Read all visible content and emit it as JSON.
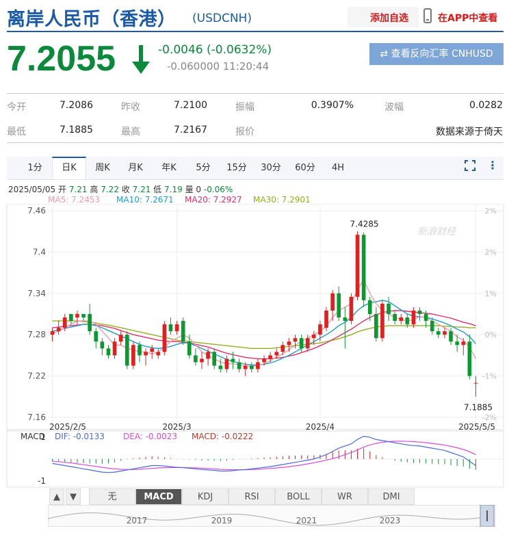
{
  "header": {
    "title": "离岸人民币（香港）",
    "code": "(USDCNH)",
    "add_favorite": "添加自选",
    "app_view": "在APP中查看"
  },
  "quote": {
    "price": "7.2055",
    "change": "-0.0046 (-0.0632%)",
    "sub": "-0.060000 11:20:44",
    "reverse_button": "查看反向汇率 CNHUSD",
    "status_color": "#0a8a3a"
  },
  "stats": {
    "row1": [
      {
        "label": "今开",
        "value": "7.2086"
      },
      {
        "label": "昨收",
        "value": "7.2100"
      },
      {
        "label": "振幅",
        "value": "0.3907%"
      },
      {
        "label": "波幅",
        "value": "0.0282"
      }
    ],
    "row2": [
      {
        "label": "最低",
        "value": "7.1885"
      },
      {
        "label": "最高",
        "value": "7.2167"
      },
      {
        "label": "报价",
        "value": "数据来源于倚天"
      }
    ]
  },
  "tabs": [
    "1分",
    "日K",
    "周K",
    "月K",
    "年K",
    "5分",
    "15分",
    "30分",
    "60分",
    "4H"
  ],
  "active_tab": "日K",
  "info_line": {
    "date": "2025/05/05",
    "open_label": "开",
    "open": "7.21",
    "high_label": "高",
    "high": "7.22",
    "close_label": "收",
    "close": "7.21",
    "low_label": "低",
    "low": "7.19",
    "vol_label": "量",
    "vol": "0",
    "pct": "-0.06%"
  },
  "ma_legend": [
    {
      "label": "MA5: 7.2453",
      "color": "#f29aa8"
    },
    {
      "label": "MA10: 7.2671",
      "color": "#1aa0c8"
    },
    {
      "label": "MA20: 7.2927",
      "color": "#e0306a"
    },
    {
      "label": "MA30: 7.2901",
      "color": "#95ad1e"
    }
  ],
  "watermark": "新浪财经",
  "chart_data": {
    "type": "candlestick",
    "y_ticks": [
      "7.46",
      "7.4",
      "7.34",
      "7.28",
      "7.22",
      "7.16"
    ],
    "y_values": [
      7.46,
      7.4,
      7.34,
      7.28,
      7.22,
      7.16
    ],
    "right_ticks": [
      "2%",
      "2%",
      "1%",
      "0%",
      "-1%",
      "-2%"
    ],
    "x_labels": [
      "2025/2/5",
      "2025/3",
      "2025/4",
      "2025/5/5"
    ],
    "x_label_index": [
      0,
      20,
      43,
      68
    ],
    "annotations": {
      "high": "7.4285",
      "low": "7.1885"
    },
    "ylim": [
      7.16,
      7.46
    ],
    "ohlc": [
      [
        7.28,
        7.29,
        7.27,
        7.285
      ],
      [
        7.285,
        7.3,
        7.28,
        7.29
      ],
      [
        7.29,
        7.31,
        7.285,
        7.305
      ],
      [
        7.31,
        7.31,
        7.295,
        7.3
      ],
      [
        7.305,
        7.315,
        7.295,
        7.31
      ],
      [
        7.31,
        7.31,
        7.3,
        7.305
      ],
      [
        7.31,
        7.325,
        7.28,
        7.285
      ],
      [
        7.285,
        7.29,
        7.26,
        7.27
      ],
      [
        7.27,
        7.275,
        7.25,
        7.26
      ],
      [
        7.26,
        7.265,
        7.245,
        7.25
      ],
      [
        7.25,
        7.275,
        7.245,
        7.27
      ],
      [
        7.27,
        7.285,
        7.265,
        7.28
      ],
      [
        7.28,
        7.285,
        7.23,
        7.235
      ],
      [
        7.235,
        7.27,
        7.23,
        7.265
      ],
      [
        7.265,
        7.27,
        7.24,
        7.25
      ],
      [
        7.25,
        7.26,
        7.235,
        7.255
      ],
      [
        7.255,
        7.265,
        7.245,
        7.26
      ],
      [
        7.25,
        7.26,
        7.245,
        7.255
      ],
      [
        7.255,
        7.3,
        7.25,
        7.295
      ],
      [
        7.295,
        7.305,
        7.28,
        7.285
      ],
      [
        7.285,
        7.3,
        7.28,
        7.295
      ],
      [
        7.3,
        7.305,
        7.265,
        7.27
      ],
      [
        7.27,
        7.28,
        7.245,
        7.25
      ],
      [
        7.25,
        7.26,
        7.235,
        7.24
      ],
      [
        7.24,
        7.255,
        7.23,
        7.245
      ],
      [
        7.245,
        7.26,
        7.235,
        7.255
      ],
      [
        7.255,
        7.26,
        7.23,
        7.235
      ],
      [
        7.235,
        7.245,
        7.225,
        7.23
      ],
      [
        7.23,
        7.25,
        7.225,
        7.245
      ],
      [
        7.245,
        7.255,
        7.23,
        7.24
      ],
      [
        7.24,
        7.245,
        7.225,
        7.23
      ],
      [
        7.23,
        7.24,
        7.22,
        7.235
      ],
      [
        7.235,
        7.24,
        7.225,
        7.23
      ],
      [
        7.23,
        7.245,
        7.225,
        7.24
      ],
      [
        7.24,
        7.25,
        7.235,
        7.245
      ],
      [
        7.245,
        7.255,
        7.24,
        7.25
      ],
      [
        7.25,
        7.26,
        7.245,
        7.255
      ],
      [
        7.255,
        7.27,
        7.25,
        7.265
      ],
      [
        7.265,
        7.275,
        7.255,
        7.27
      ],
      [
        7.27,
        7.28,
        7.26,
        7.275
      ],
      [
        7.275,
        7.28,
        7.255,
        7.26
      ],
      [
        7.26,
        7.28,
        7.255,
        7.275
      ],
      [
        7.275,
        7.285,
        7.265,
        7.28
      ],
      [
        7.28,
        7.3,
        7.27,
        7.295
      ],
      [
        7.29,
        7.32,
        7.285,
        7.315
      ],
      [
        7.315,
        7.345,
        7.3,
        7.34
      ],
      [
        7.34,
        7.35,
        7.3,
        7.305
      ],
      [
        7.305,
        7.32,
        7.26,
        7.3
      ],
      [
        7.3,
        7.34,
        7.295,
        7.335
      ],
      [
        7.335,
        7.43,
        7.33,
        7.425
      ],
      [
        7.425,
        7.4285,
        7.32,
        7.33
      ],
      [
        7.33,
        7.335,
        7.3,
        7.31
      ],
      [
        7.31,
        7.32,
        7.27,
        7.275
      ],
      [
        7.275,
        7.33,
        7.27,
        7.325
      ],
      [
        7.325,
        7.335,
        7.3,
        7.31
      ],
      [
        7.31,
        7.315,
        7.295,
        7.3
      ],
      [
        7.3,
        7.31,
        7.295,
        7.305
      ],
      [
        7.305,
        7.31,
        7.29,
        7.295
      ],
      [
        7.295,
        7.32,
        7.29,
        7.315
      ],
      [
        7.315,
        7.32,
        7.3,
        7.31
      ],
      [
        7.31,
        7.315,
        7.29,
        7.3
      ],
      [
        7.3,
        7.305,
        7.28,
        7.285
      ],
      [
        7.285,
        7.29,
        7.275,
        7.28
      ],
      [
        7.28,
        7.29,
        7.275,
        7.285
      ],
      [
        7.285,
        7.29,
        7.265,
        7.27
      ],
      [
        7.27,
        7.28,
        7.255,
        7.265
      ],
      [
        7.265,
        7.275,
        7.25,
        7.27
      ],
      [
        7.27,
        7.28,
        7.215,
        7.22
      ],
      [
        7.21,
        7.22,
        7.19,
        7.21
      ]
    ],
    "ma5": [
      7.282,
      7.285,
      7.29,
      7.295,
      7.3,
      7.3,
      7.3,
      7.295,
      7.285,
      7.275,
      7.265,
      7.265,
      7.26,
      7.258,
      7.255,
      7.255,
      7.252,
      7.255,
      7.262,
      7.27,
      7.275,
      7.28,
      7.275,
      7.265,
      7.255,
      7.25,
      7.245,
      7.24,
      7.238,
      7.238,
      7.236,
      7.234,
      7.234,
      7.235,
      7.238,
      7.242,
      7.248,
      7.252,
      7.258,
      7.265,
      7.27,
      7.275,
      7.28,
      7.285,
      7.292,
      7.305,
      7.315,
      7.32,
      7.325,
      7.345,
      7.36,
      7.34,
      7.325,
      7.315,
      7.31,
      7.305,
      7.302,
      7.3,
      7.302,
      7.306,
      7.305,
      7.3,
      7.295,
      7.29,
      7.285,
      7.277,
      7.272,
      7.262,
      7.245
    ],
    "ma10": [
      7.285,
      7.287,
      7.289,
      7.291,
      7.293,
      7.295,
      7.295,
      7.293,
      7.29,
      7.286,
      7.282,
      7.278,
      7.274,
      7.27,
      7.266,
      7.263,
      7.261,
      7.26,
      7.261,
      7.263,
      7.266,
      7.268,
      7.268,
      7.264,
      7.26,
      7.256,
      7.252,
      7.248,
      7.244,
      7.241,
      7.239,
      7.237,
      7.236,
      7.236,
      7.237,
      7.239,
      7.242,
      7.246,
      7.25,
      7.255,
      7.26,
      7.265,
      7.27,
      7.275,
      7.28,
      7.286,
      7.293,
      7.298,
      7.305,
      7.315,
      7.322,
      7.326,
      7.328,
      7.33,
      7.328,
      7.322,
      7.316,
      7.31,
      7.307,
      7.306,
      7.305,
      7.303,
      7.3,
      7.297,
      7.293,
      7.288,
      7.284,
      7.277,
      7.267
    ],
    "ma20": [
      7.29,
      7.291,
      7.292,
      7.293,
      7.294,
      7.295,
      7.295,
      7.294,
      7.293,
      7.291,
      7.289,
      7.286,
      7.283,
      7.28,
      7.278,
      7.276,
      7.274,
      7.272,
      7.271,
      7.27,
      7.27,
      7.269,
      7.268,
      7.266,
      7.264,
      7.262,
      7.259,
      7.256,
      7.253,
      7.251,
      7.249,
      7.247,
      7.246,
      7.245,
      7.245,
      7.245,
      7.246,
      7.247,
      7.249,
      7.251,
      7.254,
      7.257,
      7.26,
      7.264,
      7.268,
      7.273,
      7.278,
      7.283,
      7.288,
      7.294,
      7.3,
      7.305,
      7.309,
      7.312,
      7.314,
      7.315,
      7.315,
      7.314,
      7.313,
      7.312,
      7.311,
      7.31,
      7.308,
      7.306,
      7.304,
      7.301,
      7.298,
      7.296,
      7.293
    ],
    "ma30": [
      7.3,
      7.3,
      7.3,
      7.3,
      7.3,
      7.299,
      7.298,
      7.297,
      7.295,
      7.294,
      7.292,
      7.29,
      7.288,
      7.286,
      7.284,
      7.282,
      7.28,
      7.278,
      7.276,
      7.274,
      7.272,
      7.271,
      7.27,
      7.269,
      7.268,
      7.267,
      7.266,
      7.265,
      7.264,
      7.263,
      7.262,
      7.261,
      7.26,
      7.26,
      7.26,
      7.26,
      7.261,
      7.262,
      7.263,
      7.264,
      7.265,
      7.266,
      7.267,
      7.268,
      7.27,
      7.272,
      7.274,
      7.277,
      7.28,
      7.284,
      7.287,
      7.289,
      7.291,
      7.292,
      7.293,
      7.293,
      7.293,
      7.293,
      7.293,
      7.293,
      7.293,
      7.293,
      7.293,
      7.292,
      7.292,
      7.291,
      7.291,
      7.29,
      7.29
    ]
  },
  "macd_panel": {
    "labels": {
      "title": "MACD",
      "dif": "DIF: -0.0133",
      "dea": "DEA: -0.0023",
      "macd": "MACD: -0.0222"
    },
    "y_ticks": [
      "1",
      "-1"
    ],
    "colors": {
      "dif": "#4a6ad8",
      "dea": "#d84ad8",
      "macd": "#c0392b"
    },
    "dif": [
      -0.2,
      -0.25,
      -0.3,
      -0.35,
      -0.4,
      -0.45,
      -0.5,
      -0.55,
      -0.6,
      -0.62,
      -0.6,
      -0.55,
      -0.5,
      -0.45,
      -0.4,
      -0.35,
      -0.3,
      -0.3,
      -0.32,
      -0.35,
      -0.38,
      -0.4,
      -0.42,
      -0.45,
      -0.48,
      -0.5,
      -0.52,
      -0.55,
      -0.55,
      -0.53,
      -0.5,
      -0.48,
      -0.45,
      -0.42,
      -0.38,
      -0.35,
      -0.3,
      -0.25,
      -0.2,
      -0.15,
      -0.1,
      -0.05,
      0.0,
      0.1,
      0.2,
      0.35,
      0.5,
      0.6,
      0.7,
      0.9,
      1.05,
      1.0,
      0.9,
      0.85,
      0.8,
      0.75,
      0.7,
      0.65,
      0.62,
      0.6,
      0.55,
      0.5,
      0.45,
      0.4,
      0.3,
      0.2,
      0.1,
      -0.1,
      -0.3
    ],
    "dea": [
      -0.1,
      -0.12,
      -0.15,
      -0.18,
      -0.22,
      -0.26,
      -0.3,
      -0.34,
      -0.38,
      -0.42,
      -0.45,
      -0.47,
      -0.48,
      -0.48,
      -0.47,
      -0.45,
      -0.43,
      -0.41,
      -0.4,
      -0.39,
      -0.39,
      -0.39,
      -0.4,
      -0.41,
      -0.42,
      -0.43,
      -0.45,
      -0.47,
      -0.48,
      -0.49,
      -0.49,
      -0.49,
      -0.48,
      -0.47,
      -0.45,
      -0.43,
      -0.41,
      -0.38,
      -0.35,
      -0.31,
      -0.27,
      -0.22,
      -0.17,
      -0.11,
      -0.05,
      0.02,
      0.1,
      0.2,
      0.3,
      0.42,
      0.55,
      0.65,
      0.72,
      0.77,
      0.8,
      0.82,
      0.82,
      0.81,
      0.8,
      0.78,
      0.75,
      0.72,
      0.68,
      0.64,
      0.58,
      0.52,
      0.44,
      0.34,
      0.2
    ]
  },
  "bottom_controls": {
    "prev": "▲",
    "next": "▼",
    "indicators": [
      "无",
      "MACD",
      "KDJ",
      "RSI",
      "BOLL",
      "WR",
      "DMI"
    ],
    "active_indicator": "MACD"
  },
  "timeline": {
    "years": [
      "2017",
      "2019",
      "2021",
      "2023"
    ]
  }
}
